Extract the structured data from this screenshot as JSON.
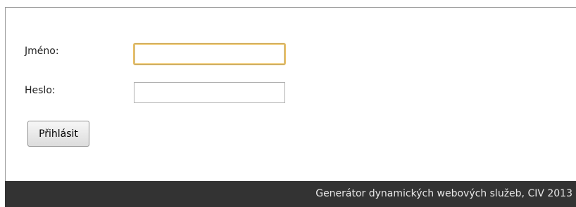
{
  "login_form": {
    "name_label": "Jméno:",
    "name_value": "",
    "password_label": "Heslo:",
    "password_value": "",
    "submit_label": "Přihlásit"
  },
  "footer": {
    "text": "Generátor dynamických webových služeb, CIV 2013"
  }
}
